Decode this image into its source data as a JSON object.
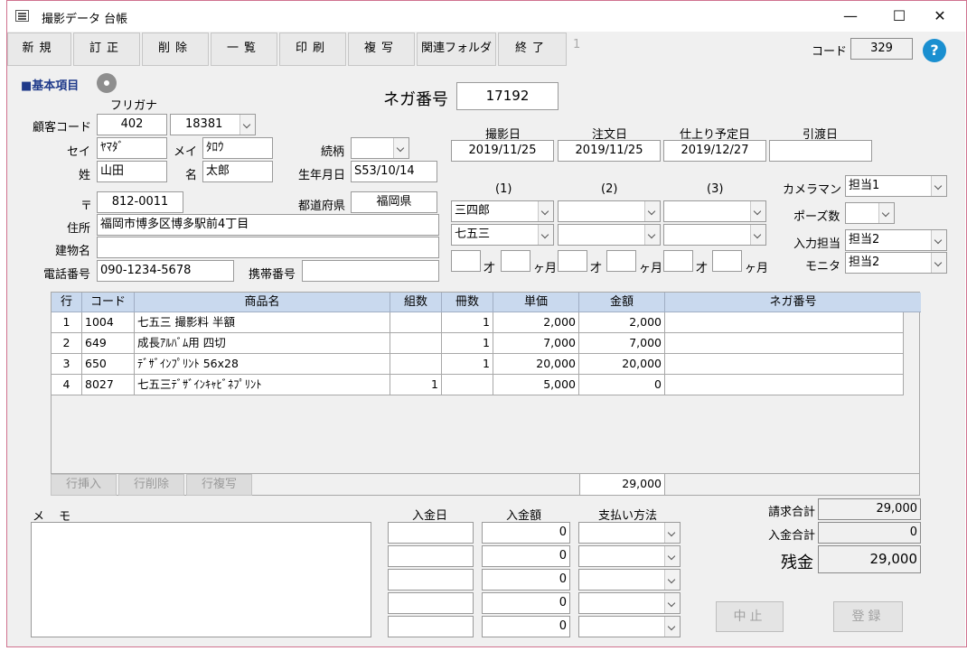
{
  "window": {
    "title": "撮影データ 台帳",
    "minimize": "—",
    "maximize": "☐",
    "close": "✕"
  },
  "toolbar": {
    "new": "新規",
    "edit": "訂正",
    "delete": "削除",
    "list": "一覧",
    "print": "印刷",
    "copy": "複写",
    "folder": "関連フォルダ",
    "exit": "終了",
    "record_no": "1"
  },
  "code": {
    "label": "コード",
    "value": "329"
  },
  "section": {
    "title": "■基本項目"
  },
  "nega": {
    "label": "ネガ番号",
    "value": "17192"
  },
  "furigana_label": "フリガナ",
  "customer": {
    "code_label": "顧客コード",
    "code1": "402",
    "code2": "18381",
    "sei_label": "セイ",
    "sei": "ﾔﾏﾀﾞ",
    "mei_label": "メイ",
    "mei": "ﾀﾛｳ",
    "sei_kanji_label": "姓",
    "sei_kanji": "山田",
    "mei_kanji_label": "名",
    "mei_kanji": "太郎",
    "relation_label": "続柄",
    "relation": "",
    "birth_label": "生年月日",
    "birth": "S53/10/14",
    "zip_label": "〒",
    "zip": "812-0011",
    "pref_label": "都道府県",
    "pref": "福岡県",
    "address_label": "住所",
    "address": "福岡市博多区博多駅前4丁目",
    "building_label": "建物名",
    "building": "",
    "phone_label": "電話番号",
    "phone": "090-1234-5678",
    "mobile_label": "携帯番号",
    "mobile": ""
  },
  "dates": {
    "shoot_label": "撮影日",
    "shoot": "2019/11/25",
    "order_label": "注文日",
    "order": "2019/11/25",
    "finish_label": "仕上り予定日",
    "finish": "2019/12/27",
    "delivery_label": "引渡日",
    "delivery": ""
  },
  "subjects": {
    "col1": "(1)",
    "col2": "(2)",
    "col3": "(3)",
    "name1": "三四郎",
    "event1": "七五三",
    "age_unit": "才",
    "month_unit": "ヶ月"
  },
  "staff": {
    "camera_label": "カメラマン",
    "camera": "担当1",
    "poses_label": "ポーズ数",
    "poses": "",
    "input_label": "入力担当",
    "input": "担当2",
    "monitor_label": "モニタ",
    "monitor": "担当2"
  },
  "items": {
    "headers": [
      "行",
      "コード",
      "商品名",
      "組数",
      "冊数",
      "単価",
      "金額",
      "ネガ番号"
    ],
    "rows": [
      {
        "no": "1",
        "code": "1004",
        "name": "七五三 撮影料 半額",
        "sets": "",
        "books": "1",
        "price": "2,000",
        "amount": "2,000",
        "nega": ""
      },
      {
        "no": "2",
        "code": "649",
        "name": "成長ｱﾙﾊﾞﾑ用 四切",
        "sets": "",
        "books": "1",
        "price": "7,000",
        "amount": "7,000",
        "nega": ""
      },
      {
        "no": "3",
        "code": "650",
        "name": "ﾃﾞｻﾞｲﾝﾌﾟﾘﾝﾄ 56x28",
        "sets": "",
        "books": "1",
        "price": "20,000",
        "amount": "20,000",
        "nega": ""
      },
      {
        "no": "4",
        "code": "8027",
        "name": "七五三ﾃﾞｻﾞｲﾝｷｬﾋﾞﾈﾌﾟﾘﾝﾄ",
        "sets": "1",
        "books": "",
        "price": "5,000",
        "amount": "0",
        "nega": ""
      }
    ],
    "total": "29,000",
    "insert_row": "行挿入",
    "delete_row": "行削除",
    "copy_row": "行複写"
  },
  "memo_label": "メ モ",
  "payments": {
    "date_label": "入金日",
    "amount_label": "入金額",
    "method_label": "支払い方法",
    "amounts": [
      "0",
      "0",
      "0",
      "0",
      "0"
    ]
  },
  "totals": {
    "billing_label": "請求合計",
    "billing": "29,000",
    "paid_label": "入金合計",
    "paid": "0",
    "balance_label": "残金",
    "balance": "29,000"
  },
  "actions": {
    "cancel": "中止",
    "register": "登録"
  }
}
